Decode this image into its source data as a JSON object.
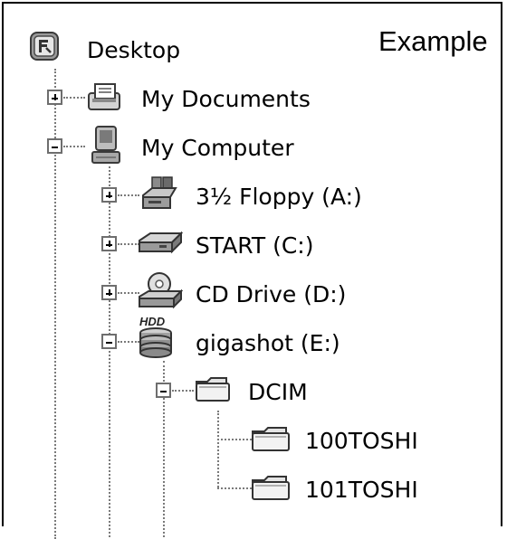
{
  "title": "Example",
  "tree": {
    "desktop": {
      "label": "Desktop",
      "icon": "desktop-icon"
    },
    "my_documents": {
      "label": "My Documents",
      "icon": "my-documents-icon",
      "state": "collapsed"
    },
    "my_computer": {
      "label": "My Computer",
      "icon": "computer-icon",
      "state": "expanded"
    },
    "floppy": {
      "label": "3½ Floppy (A:)",
      "icon": "floppy-drive-icon",
      "state": "collapsed"
    },
    "start_c": {
      "label": "START (C:)",
      "icon": "hard-drive-icon",
      "state": "collapsed"
    },
    "cd_drive": {
      "label": "CD Drive (D:)",
      "icon": "cd-drive-icon",
      "state": "collapsed"
    },
    "gigashot": {
      "label": "gigashot (E:)",
      "icon": "hdd-icon",
      "state": "expanded"
    },
    "dcim": {
      "label": "DCIM",
      "icon": "folder-icon",
      "state": "expanded"
    },
    "folder_100": {
      "label": "100TOSHI",
      "icon": "folder-icon"
    },
    "folder_101": {
      "label": "101TOSHI",
      "icon": "folder-icon"
    }
  }
}
